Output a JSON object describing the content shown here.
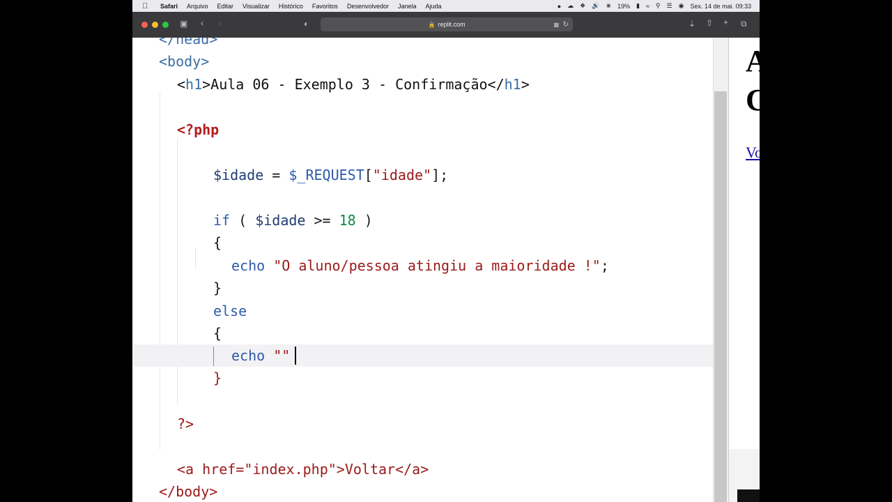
{
  "menubar": {
    "app": "Safari",
    "items": [
      "Arquivo",
      "Editar",
      "Visualizar",
      "Histórico",
      "Favoritos",
      "Desenvolvedor",
      "Janela",
      "Ajuda"
    ],
    "battery": "19%",
    "datetime": "Sex. 14 de mai.  09:33"
  },
  "browser": {
    "url": "replit.com"
  },
  "code": {
    "head_close": "</head>",
    "body_open": "<body>",
    "h1_line": [
      "<",
      "h1",
      ">Aula 06 - Exemplo 3 - Confirmação</",
      "h1",
      ">"
    ],
    "php_open": "<?php",
    "idade_var": "$idade",
    "assign": " = ",
    "request": "$_REQUEST",
    "req_open": "[",
    "req_key": "\"idade\"",
    "req_close": "];",
    "if_kw": "if",
    "if_open": " ( ",
    "if_var": "$idade",
    "if_op": " >= ",
    "if_num": "18",
    "if_close": " )",
    "brace_open": "{",
    "echo_kw": "echo",
    "echo_str": "\"O aluno/pessoa atingiu a maioridade !\"",
    "semicolon": ";",
    "brace_close": "}",
    "else_kw": "else",
    "brace_open2": "{",
    "echo_kw2": "echo",
    "echo_str2": "\"\"",
    "brace_close2": "}",
    "php_close": "?>",
    "a_line": [
      "<a href=",
      "\"index.php\"",
      ">Voltar</a>"
    ],
    "body_close": "</body>"
  },
  "preview": {
    "heading_start": "A",
    "heading_second": "C",
    "link_start": "Vo"
  }
}
